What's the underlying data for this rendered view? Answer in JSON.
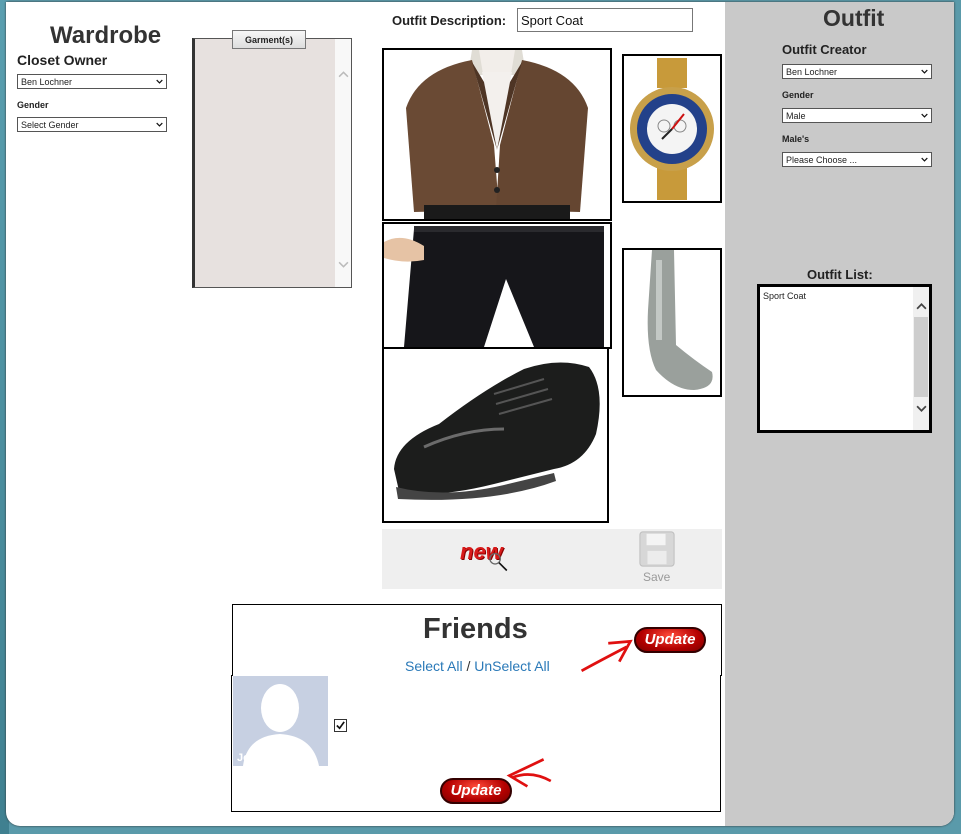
{
  "wardrobe": {
    "title": "Wardrobe",
    "closet_owner_label": "Closet Owner",
    "closet_owner_value": "Ben Lochner",
    "gender_label": "Gender",
    "gender_value": "Select Gender",
    "garments_tab": "Garment(s)"
  },
  "center": {
    "outfit_description_label": "Outfit Description:",
    "outfit_description_value": "Sport Coat",
    "save_label": "Save",
    "new_label": "new"
  },
  "outfit": {
    "title": "Outfit",
    "creator_label": "Outfit Creator",
    "creator_value": "Ben Lochner",
    "gender_label": "Gender",
    "gender_value": "Male",
    "males_label": "Male's",
    "males_value": "Please Choose ...",
    "list_label": "Outfit List:",
    "list_items": [
      "Sport Coat"
    ]
  },
  "friends": {
    "title": "Friends",
    "select_all": "Select All",
    "separator": "/",
    "unselect_all": "UnSelect All",
    "update_label": "Update",
    "friend_name_fragment": "Jo"
  },
  "colors": {
    "right_panel": "#c9c9c9",
    "link": "#2a79b8",
    "update_button": "#c00000",
    "annotation_arrow": "#e01010"
  }
}
